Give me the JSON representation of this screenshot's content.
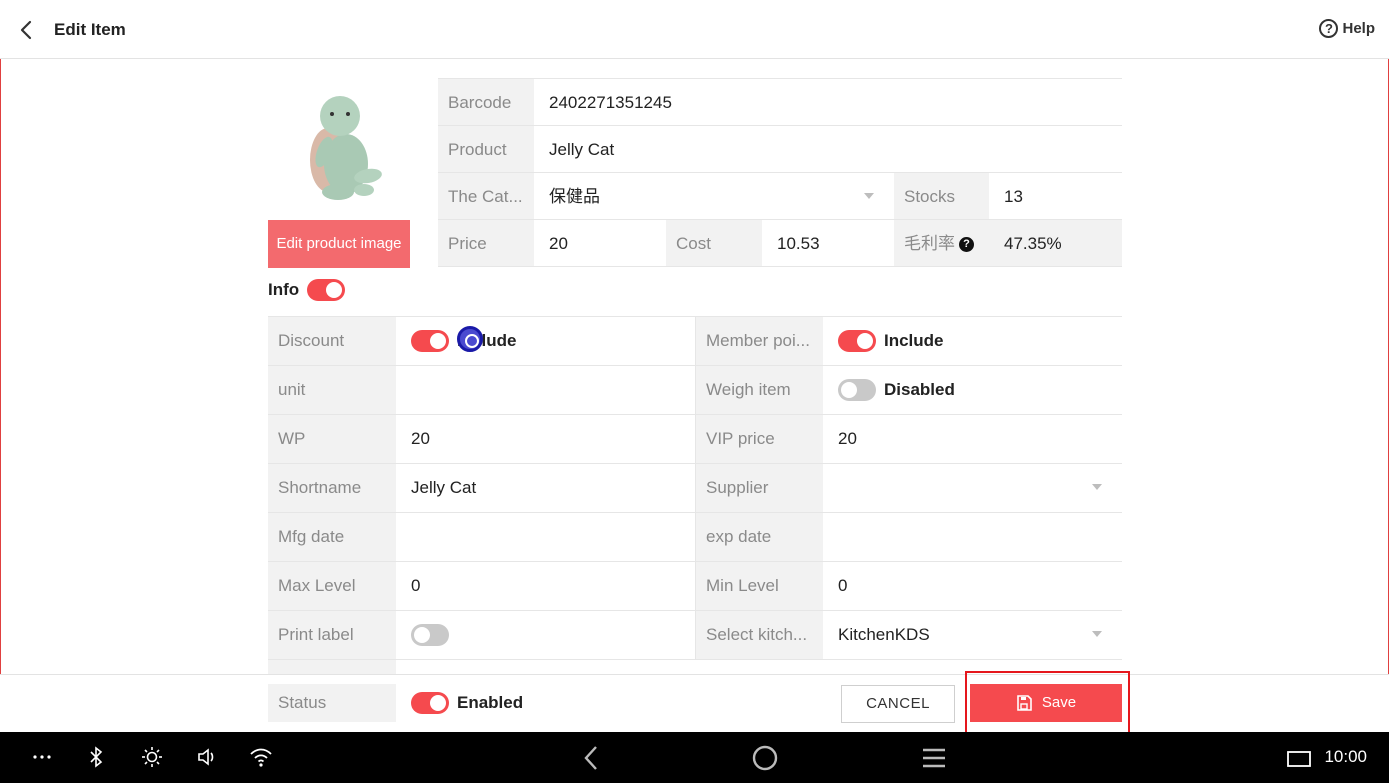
{
  "header": {
    "title": "Edit Item",
    "help_label": "Help",
    "help_symbol": "?"
  },
  "product": {
    "edit_image_label": "Edit product image",
    "barcode_label": "Barcode",
    "barcode_value": "2402271351245",
    "product_label": "Product",
    "product_value": "Jelly Cat",
    "category_label": "The Cat...",
    "category_value": "保健品",
    "stocks_label": "Stocks",
    "stocks_value": "13",
    "price_label": "Price",
    "price_value": "20",
    "cost_label": "Cost",
    "cost_value": "10.53",
    "margin_label": "毛利率",
    "margin_value": "47.35%"
  },
  "info": {
    "label": "Info",
    "enabled": true,
    "discount_label": "Discount",
    "discount_state": "Include",
    "member_points_label": "Member poi...",
    "member_points_state": "Include",
    "unit_label": "unit",
    "unit_value": "",
    "weigh_item_label": "Weigh item",
    "weigh_item_state": "Disabled",
    "wp_label": "WP",
    "wp_value": "20",
    "vip_price_label": "VIP price",
    "vip_price_value": "20",
    "shortname_label": "Shortname",
    "shortname_value": "Jelly Cat",
    "supplier_label": "Supplier",
    "supplier_value": "",
    "mfg_date_label": "Mfg date",
    "mfg_date_value": "",
    "exp_date_label": "exp date",
    "exp_date_value": "",
    "max_level_label": "Max Level",
    "max_level_value": "0",
    "min_level_label": "Min Level",
    "min_level_value": "0",
    "print_label_label": "Print label",
    "select_kitchen_label": "Select kitch...",
    "select_kitchen_value": "KitchenKDS"
  },
  "footer": {
    "status_label": "Status",
    "status_state": "Enabled",
    "cancel_label": "CANCEL",
    "save_label": "Save"
  },
  "system_bar": {
    "clock": "10:00"
  },
  "colors": {
    "accent": "#f54a4e",
    "image_button": "#f36a6e",
    "highlight": "#e5171d"
  }
}
